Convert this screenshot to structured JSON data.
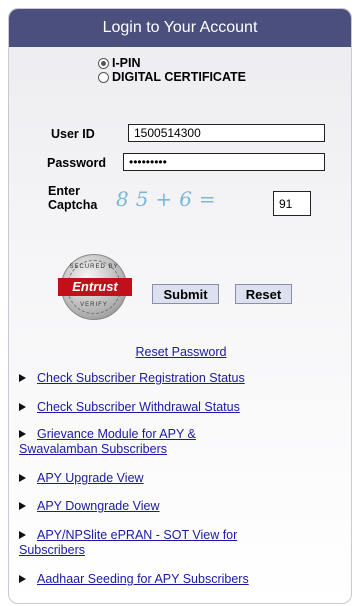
{
  "header": {
    "title": "Login to Your Account"
  },
  "auth_mode": {
    "options": [
      "I-PIN",
      "DIGITAL CERTIFICATE"
    ],
    "selected": "I-PIN"
  },
  "form": {
    "user_id_label": "User ID",
    "user_id_value": "1500514300",
    "password_label": "Password",
    "password_value": "•••••••••",
    "captcha_label_line1": "Enter",
    "captcha_label_line2": "Captcha",
    "captcha_text": "85+6=",
    "captcha_answer": "91"
  },
  "seal": {
    "brand": "Entrust",
    "top_text": "SECURED BY",
    "bottom_text": "VERIFY"
  },
  "buttons": {
    "submit": "Submit",
    "reset": "Reset"
  },
  "reset_password_link": "Reset Password",
  "links": [
    {
      "text": "Check Subscriber Registration Status"
    },
    {
      "text": "Check Subscriber Withdrawal Status"
    },
    {
      "line1": "Grievance Module for APY &",
      "line2": "Swavalamban Subscribers"
    },
    {
      "text": "APY Upgrade View"
    },
    {
      "text": "APY Downgrade View"
    },
    {
      "line1": "APY/NPSlite ePRAN - SOT View for",
      "line2": "Subscribers"
    },
    {
      "text": "Aadhaar Seeding for APY Subscribers"
    }
  ],
  "colors": {
    "header_bg": "#4b4f7e",
    "link": "#1a1aa6",
    "button_bg": "#dde0ef",
    "seal_band": "#c2101a"
  }
}
